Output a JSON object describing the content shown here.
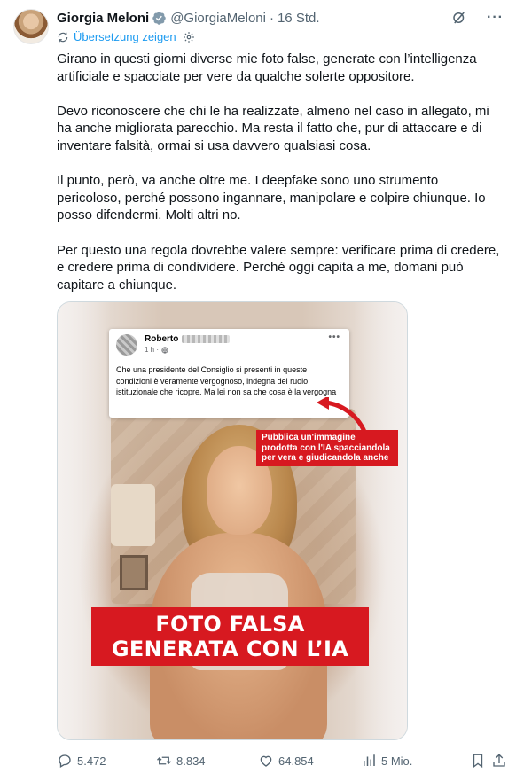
{
  "author": {
    "name": "Giorgia Meloni",
    "handle": "@GiorgiaMeloni",
    "separator": "·",
    "time": "16 Std."
  },
  "translate_label": "Übersetzung zeigen",
  "paragraphs": [
    "Girano in questi giorni diverse mie foto false, generate con l’intelligenza artificiale e spacciate per vere da qualche solerte oppositore.",
    "Devo riconoscere che chi le ha realizzate, almeno nel caso in allegato, mi ha anche migliorata parecchio. Ma resta il fatto che, pur di attaccare e di inventare falsità, ormai si usa davvero qualsiasi cosa.",
    "Il punto, però, va anche oltre me. I deepfake sono uno strumento pericoloso, perché possono ingannare, manipolare e colpire chiunque. Io posso difendermi. Molti altri no.",
    "Per questo una regola dovrebbe valere sempre: verificare prima di credere, e credere prima di condividere. Perché oggi capita a me, domani può capitare a chiunque."
  ],
  "media": {
    "fb_post": {
      "name": "Roberto",
      "time": "1 h ·",
      "text": "Che una presidente del Consiglio  si presenti in queste condizioni è veramente vergognoso, indegna del ruolo istituzionale che ricopre. Ma lei non sa che cosa è la vergogna"
    },
    "caption": "Pubblica un'immagine prodotta con l'IA spacciandola per vera e giudicandola anche",
    "banner_line1": "FOTO FALSA",
    "banner_line2": "GENERATA CON L’IA"
  },
  "stats": {
    "replies": "5.472",
    "reposts": "8.834",
    "likes": "64.854",
    "views": "5 Mio."
  },
  "colors": {
    "accent": "#1d9bf0",
    "muted": "#536471",
    "banner_red": "#d71920"
  }
}
